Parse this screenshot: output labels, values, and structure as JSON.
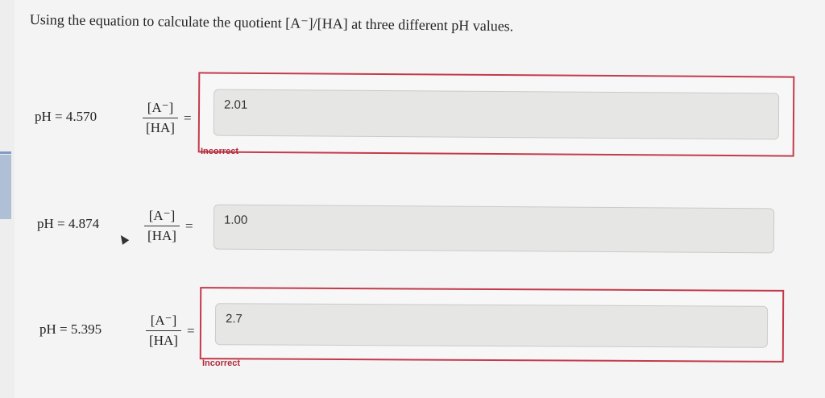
{
  "question": {
    "text": "Using the equation to calculate the quotient [A⁻]/[HA] at three different pH values."
  },
  "rows": [
    {
      "ph_label": "pH = 4.570",
      "numerator": "[A⁻]",
      "denominator": "[HA]",
      "equals": "=",
      "answer": "2.01",
      "status": "Incorrect"
    },
    {
      "ph_label": "pH = 4.874",
      "numerator": "[A⁻]",
      "denominator": "[HA]",
      "equals": "=",
      "answer": "1.00",
      "status": ""
    },
    {
      "ph_label": "pH = 5.395",
      "numerator": "[A⁻]",
      "denominator": "[HA]",
      "equals": "=",
      "answer": "2.7",
      "status": "Incorrect"
    }
  ],
  "colors": {
    "error": "#c43a4b",
    "field": "#e6e7e5"
  }
}
